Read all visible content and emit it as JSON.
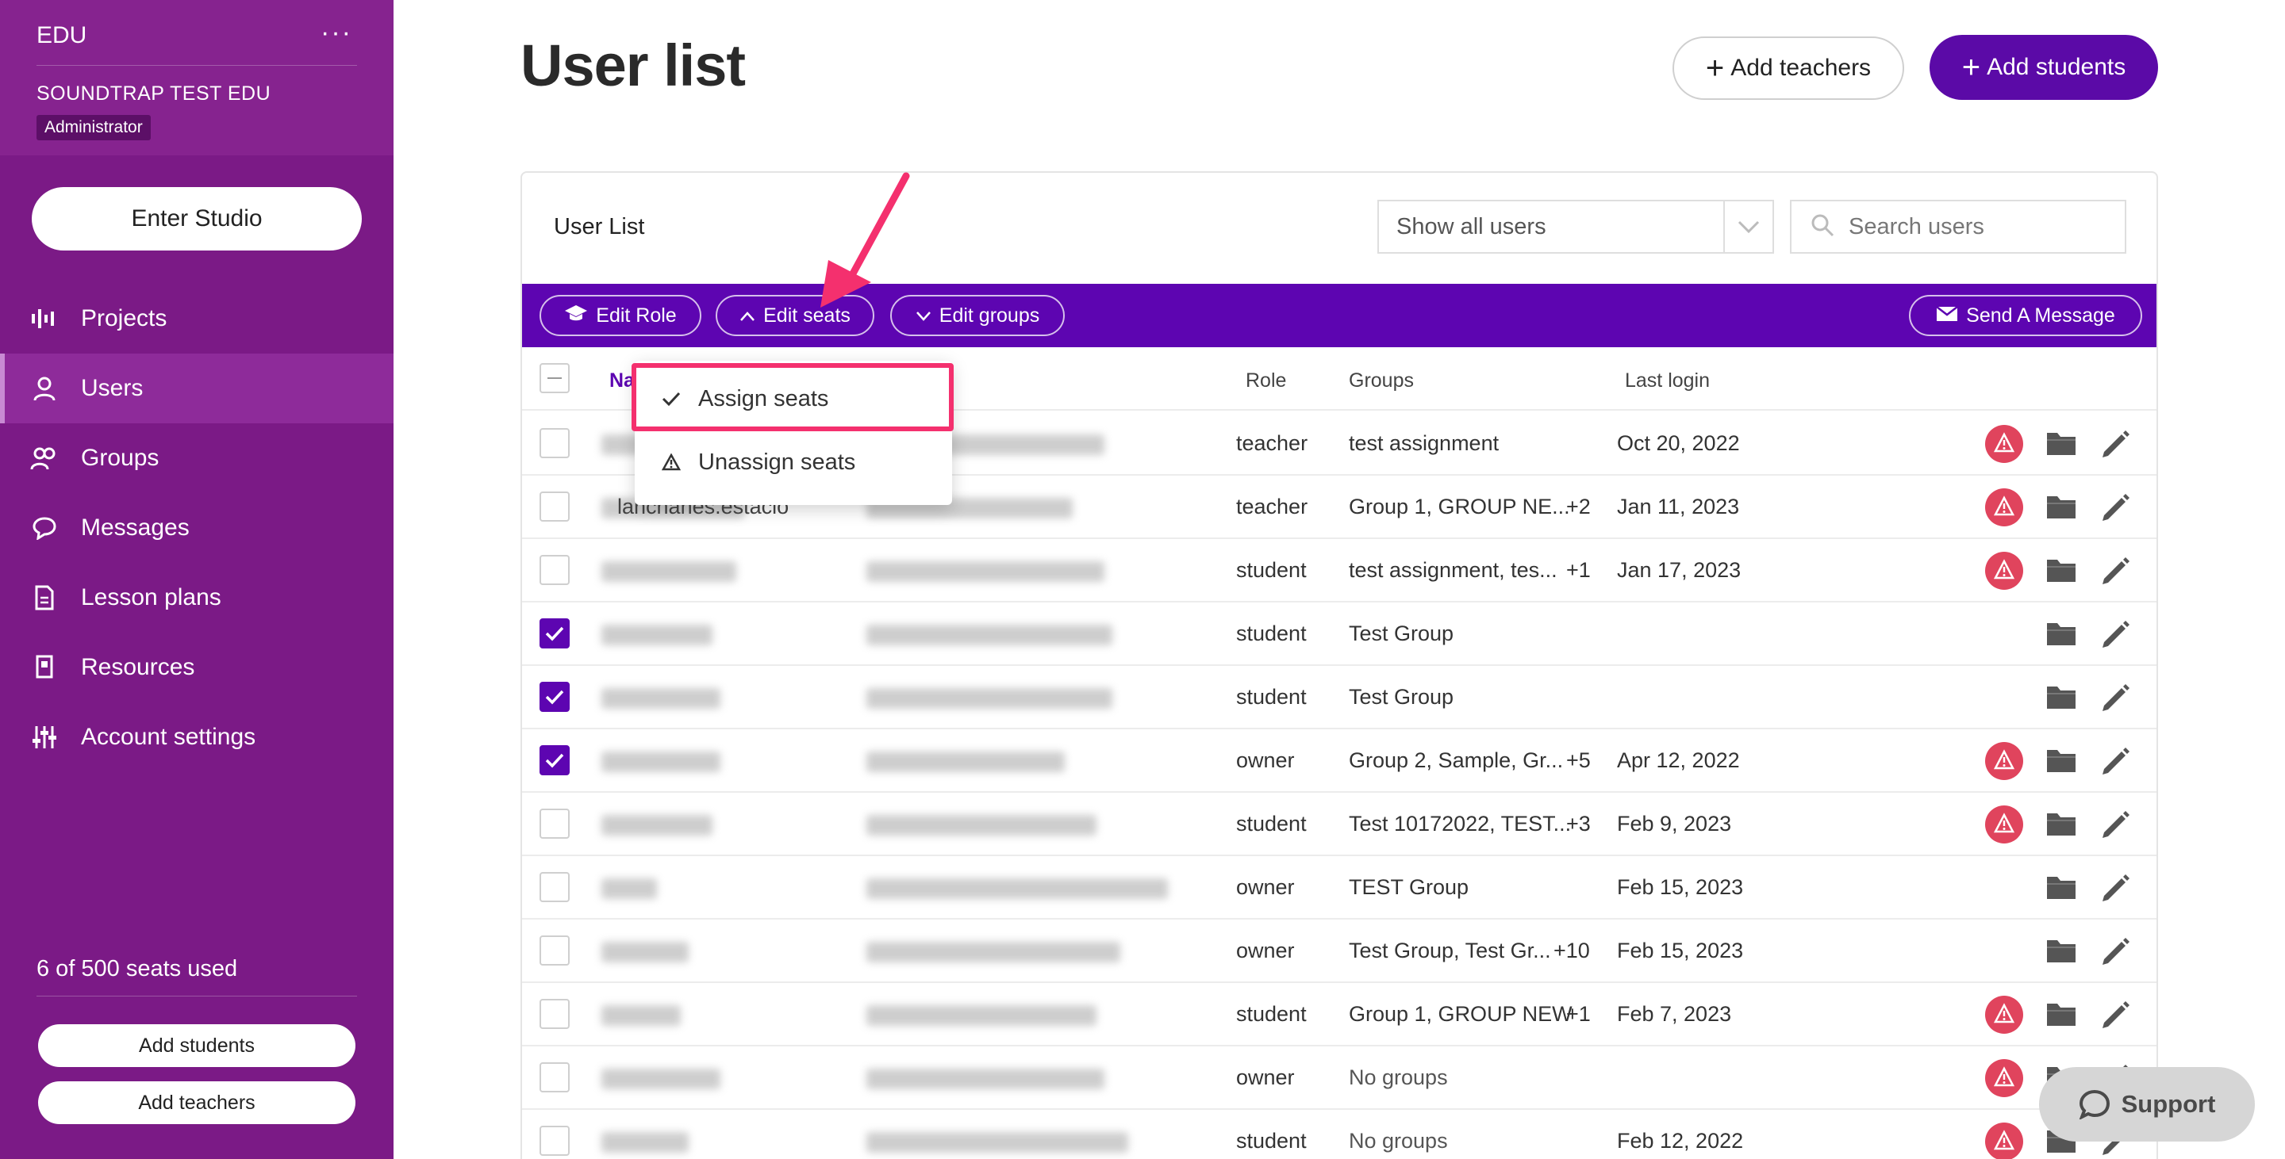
{
  "sidebar": {
    "org_label": "EDU",
    "more_icon": "ellipsis-icon",
    "school_name": "SOUNDTRAP TEST EDU",
    "role_badge": "Administrator",
    "enter_studio": "Enter Studio",
    "nav": [
      {
        "label": "Projects",
        "icon": "waveform-icon"
      },
      {
        "label": "Users",
        "icon": "user-icon",
        "active": true
      },
      {
        "label": "Groups",
        "icon": "users-icon"
      },
      {
        "label": "Messages",
        "icon": "chat-bubble-icon"
      },
      {
        "label": "Lesson plans",
        "icon": "document-icon"
      },
      {
        "label": "Resources",
        "icon": "bookmark-icon"
      },
      {
        "label": "Account settings",
        "icon": "sliders-icon"
      }
    ],
    "seats_used": "6 of 500 seats used",
    "add_students": "Add students",
    "add_teachers": "Add teachers"
  },
  "header": {
    "title": "User list",
    "add_teachers": "Add teachers",
    "add_students": "Add students"
  },
  "card": {
    "title": "User List",
    "filter_value": "Show all users",
    "search_placeholder": "Search users"
  },
  "toolbar": {
    "edit_role": "Edit Role",
    "edit_seats": "Edit seats",
    "edit_groups": "Edit groups",
    "send_message": "Send A Message"
  },
  "table": {
    "columns": {
      "name": "Name",
      "role": "Role",
      "groups": "Groups",
      "last_login": "Last login"
    },
    "rows": [
      {
        "checked": false,
        "name": "",
        "role": "teacher",
        "groups": "test assignment",
        "more": "",
        "last_login": "Oct 20, 2022",
        "warning": true
      },
      {
        "checked": false,
        "name": "lanchanes.estacio",
        "role": "teacher",
        "groups": "Group 1, GROUP NE...",
        "more": "+2",
        "last_login": "Jan 11, 2023",
        "warning": true
      },
      {
        "checked": false,
        "name": "",
        "role": "student",
        "groups": "test assignment, tes...",
        "more": "+1",
        "last_login": "Jan 17, 2023",
        "warning": true
      },
      {
        "checked": true,
        "name": "",
        "role": "student",
        "groups": "Test Group",
        "more": "",
        "last_login": "",
        "warning": false
      },
      {
        "checked": true,
        "name": "",
        "role": "student",
        "groups": "Test Group",
        "more": "",
        "last_login": "",
        "warning": false
      },
      {
        "checked": true,
        "name": "",
        "role": "owner",
        "groups": "Group 2, Sample, Gr...",
        "more": "+5",
        "last_login": "Apr 12, 2022",
        "warning": true
      },
      {
        "checked": false,
        "name": "",
        "role": "student",
        "groups": "Test 10172022, TEST...",
        "more": "+3",
        "last_login": "Feb 9, 2023",
        "warning": true
      },
      {
        "checked": false,
        "name": "",
        "role": "owner",
        "groups": "TEST Group",
        "more": "",
        "last_login": "Feb 15, 2023",
        "warning": false
      },
      {
        "checked": false,
        "name": "",
        "role": "owner",
        "groups": "Test Group, Test Gr...",
        "more": "+10",
        "last_login": "Feb 15, 2023",
        "warning": false
      },
      {
        "checked": false,
        "name": "",
        "role": "student",
        "groups": "Group 1, GROUP NEW",
        "more": "+1",
        "last_login": "Feb 7, 2023",
        "warning": true
      },
      {
        "checked": false,
        "name": "",
        "role": "owner",
        "groups": "No groups",
        "more": "",
        "last_login": "",
        "warning": true
      },
      {
        "checked": false,
        "name": "",
        "role": "student",
        "groups": "No groups",
        "more": "",
        "last_login": "Feb 12, 2022",
        "warning": true
      }
    ]
  },
  "dropdown": {
    "assign": "Assign seats",
    "unassign": "Unassign seats"
  },
  "support": {
    "label": "Support"
  },
  "colors": {
    "sidebar": "#7b1a86",
    "primary": "#5b0aa7",
    "toolbar": "#5d05b1",
    "warning": "#e0445d",
    "annotation": "#f4306e"
  }
}
